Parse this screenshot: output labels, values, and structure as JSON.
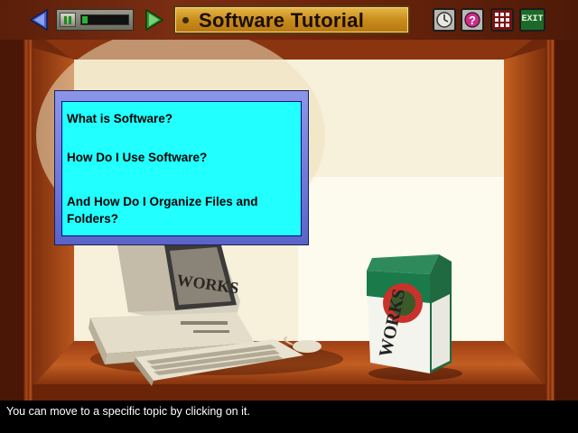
{
  "toolbar": {
    "title": "Software Tutorial",
    "media_progress": 0.12,
    "exit_label": "EXIT",
    "icons": {
      "back": "left-arrow-icon",
      "forward": "right-arrow-icon",
      "pause": "pause-icon",
      "clock": "clock-icon",
      "help": "question-mark-icon",
      "grid": "topic-grid-icon"
    }
  },
  "topics": {
    "items": [
      {
        "label": "What is Software?"
      },
      {
        "label": "How Do I Use Software?"
      },
      {
        "label": "And How Do I Organize Files and Folders?"
      }
    ]
  },
  "shelf": {
    "box_text": "WORKS"
  },
  "status": {
    "text": "You can move to a specific topic by clicking on it."
  },
  "colors": {
    "topic_background": "#22ffff",
    "toolbar_wood": "#7a2e12",
    "title_plaque": "#d4a030"
  }
}
